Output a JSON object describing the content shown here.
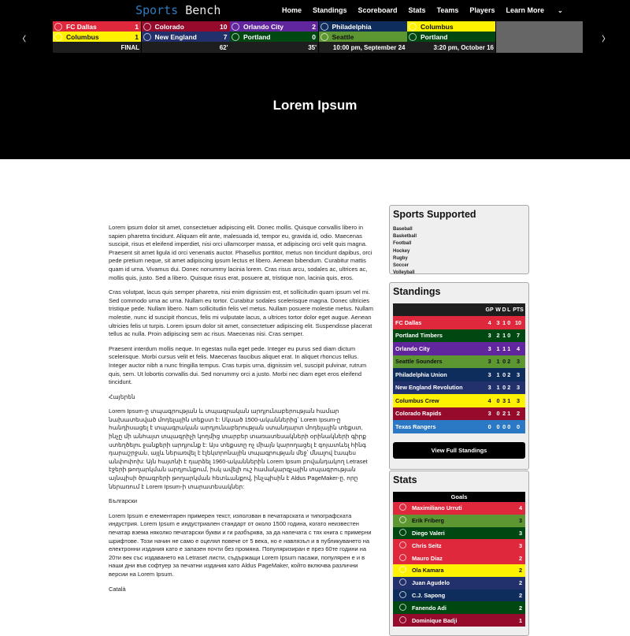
{
  "header": {
    "logo_part1": "Sports",
    "logo_part2": " Bench",
    "nav": [
      "Home",
      "Standings",
      "Scoreboard",
      "Stats",
      "Teams",
      "Players",
      "Learn More"
    ],
    "prev_label": "‹",
    "next_label": "›"
  },
  "scoreboard": [
    {
      "home": {
        "name": "FC Dallas",
        "score": "1",
        "color": "#e0283c"
      },
      "away": {
        "name": "Columbus",
        "score": "1",
        "color": "#fef200",
        "text": "#111"
      },
      "status": "FINAL"
    },
    {
      "home": {
        "name": "Colorado",
        "score": "10",
        "color": "#960a2c"
      },
      "away": {
        "name": "New England",
        "score": "7",
        "color": "#22306b"
      },
      "status": "62'"
    },
    {
      "home": {
        "name": "Orlando City",
        "score": "2",
        "color": "#61259e"
      },
      "away": {
        "name": "Portland",
        "score": "0",
        "color": "#004812"
      },
      "status": "35'"
    },
    {
      "home": {
        "name": "Philadelphia",
        "score": "",
        "color": "#0f2d5c"
      },
      "away": {
        "name": "Seattle",
        "score": "",
        "color": "#5d9732",
        "text": "#111"
      },
      "status": "10:00 pm, September 24"
    },
    {
      "home": {
        "name": "Columbus",
        "score": "",
        "color": "#fef200",
        "text": "#111"
      },
      "away": {
        "name": "Portland",
        "score": "",
        "color": "#004812"
      },
      "status": "3:20 pm, October 16"
    }
  ],
  "hero": {
    "title": "Lorem Ipsum"
  },
  "content": {
    "paragraphs": [
      "Lorem ipsum dolor sit amet, consectetuer adipiscing elit. Donec mollis. Quisque convallis libero in sapien pharetra tincidunt. Aliquam elit ante, malesuada id, tempor eu, gravida id, odio. Maecenas suscipit, risus et eleifend imperdiet, nisi orci ullamcorper massa, et adipiscing orci velit quis magna. Praesent sit amet ligula id orci venenatis auctor. Phasellus porttitor, metus non tincidunt dapibus, orci pede pretium neque, sit amet adipiscing ipsum lectus et libero. Aenean bibendum. Curabitur mattis quam id urna. Vivamus dui. Donec nonummy lacinia lorem. Cras risus arcu, sodales ac, ultrices ac, mollis quis, justo. Sed a libero. Quisque risus erat, posuere at, tristique non, lacinia quis, eros.",
      "Cras volutpat, lacus quis semper pharetra, nisi enim dignissim est, et sollicitudin quam ipsum vel mi. Sed commodo urna ac urna. Nullam eu tortor. Curabitur sodales scelerisque magna. Donec ultricies tristique pede. Nullam libero. Nam sollicitudin felis vel metus. Nullam posuere molestie metus. Nullam molestie, nunc id suscipit rhoncus, felis mi vulputate lacus, a ultrices tortor dolor eget augue. Aenean ultricies felis ut turpis. Lorem ipsum dolor sit amet, consectetuer adipiscing elit. Suspendisse placerat tellus ac nulla. Proin adipiscing sem ac risus. Maecenas nisi. Cras semper.",
      "Praesent interdum mollis neque. In egestas nulla eget pede. Integer eu purus sed diam dictum scelerisque. Morbi cursus velit et felis. Maecenas faucibus aliquet erat. In aliquet rhoncus tellus. Integer auctor nibh a nunc fringilla tempus. Cras turpis urna, dignissim vel, suscipit pulvinar, rutrum quis, sem. Ut lobortis convallis dui. Sed nonummy orci a justo. Morbi nec diam eget eros eleifend tincidunt."
    ],
    "heading_armenian": "Հայերեն",
    "para_armenian": "Lorem Ipsum-ը տպագրության և տպագրական արդյունաբերության համար նախատեսված մոդելային տեքստ է: Սկսած 1500-ականներից՝ Lorem Ipsum-ը հանդիսացել է տպագրական արդյունաբերության ստանդարտ մոդելային տեքստ, ինչը մի անհայտ տպագրիչի կողմից տարբեր տառատեսակների օրինակների գիրք ստեղծելու ջանքերի արդյունք է: Այս տեքստը ոչ միայն կարողացել է գոյատևել հինգ դարաշրջան, այլև ներառվել է էլեկտրոնային տպագրության մեջ՝ մնալով էապես անփոփոխ: Այն հայտնի է դարձել 1960-ականներին Lorem Ipsum բովանդակող Letraset էջերի թողարկման արդյունքում, իսկ ավելի ուշ համակարգչային տպագրության այնպիսի ծրագրերի թողարկման հետևանքով, ինչպիսին է Aldus PageMaker-ը, որը ներառում է Lorem Ipsum-ի տարատեսակներ:",
    "heading_bulgarian": "Български",
    "para_bulgarian": "Lorem Ipsum е елементарен примерен текст, използван в печатарската и типографската индустрия. Lorem Ipsum е индустриален стандарт от около 1500 година, когато неизвестен печатар взема няколко печатарски букви и ги разбърква, за да напечата с тях книга с примерни шрифтове. Този начин не само е оцелял повече от 5 века, но е навлязъл и в публикуването на електронни издания като е запазен почти без промяна. Популяризиран е през 60те години на 20ти век със издаването на Letraset листи, съдържащи Lorem Ipsum пасажи, популярен е и в наши дни във софтуер за печатни издания като Aldus PageMaker, който включва различни версии на Lorem Ipsum.",
    "heading_catalan": "Català"
  },
  "sports_supported": {
    "title": "Sports Supported",
    "items": [
      "Baseball",
      "Basketball",
      "Football",
      "Hockey",
      "Rugby",
      "Soccer",
      "Volleyball"
    ]
  },
  "standings": {
    "title": "Standings",
    "columns": [
      "",
      "GP",
      "W",
      "D",
      "L",
      "PTS"
    ],
    "rows": [
      {
        "team": "FC Dallas",
        "gp": "4",
        "w": "3",
        "d": "1",
        "l": "0",
        "pts": "10",
        "color": "#e0283c",
        "text": "#fff"
      },
      {
        "team": "Portland Timbers",
        "gp": "3",
        "w": "2",
        "d": "1",
        "l": "0",
        "pts": "7",
        "color": "#004812",
        "text": "#fff"
      },
      {
        "team": "Orlando City",
        "gp": "3",
        "w": "1",
        "d": "1",
        "l": "1",
        "pts": "4",
        "color": "#61259e",
        "text": "#fff"
      },
      {
        "team": "Seattle Sounders",
        "gp": "3",
        "w": "1",
        "d": "0",
        "l": "2",
        "pts": "3",
        "color": "#5d9732",
        "text": "#111"
      },
      {
        "team": "Philadelphia Union",
        "gp": "3",
        "w": "1",
        "d": "0",
        "l": "2",
        "pts": "3",
        "color": "#0f2d5c",
        "text": "#fff"
      },
      {
        "team": "New England Revolution",
        "gp": "3",
        "w": "1",
        "d": "0",
        "l": "2",
        "pts": "3",
        "color": "#22306b",
        "text": "#fff"
      },
      {
        "team": "Columbus Crew",
        "gp": "4",
        "w": "0",
        "d": "3",
        "l": "1",
        "pts": "3",
        "color": "#fef200",
        "text": "#111"
      },
      {
        "team": "Colorado Rapids",
        "gp": "3",
        "w": "0",
        "d": "2",
        "l": "1",
        "pts": "2",
        "color": "#960a2c",
        "text": "#fff"
      },
      {
        "team": "Texas Rangers",
        "gp": "0",
        "w": "0",
        "d": "0",
        "l": "0",
        "pts": "0",
        "color": "#2b78c5",
        "text": "#fff"
      }
    ],
    "button_label": "View Full Standings"
  },
  "stats": {
    "title": "Stats",
    "goals_header": "Goals",
    "rows": [
      {
        "player": "Maximiliano Urruti",
        "value": "4",
        "color": "#e0283c",
        "text": "#fff"
      },
      {
        "player": "Erik Friberg",
        "value": "3",
        "color": "#5d9732",
        "text": "#111"
      },
      {
        "player": "Diego Valeri",
        "value": "3",
        "color": "#004812",
        "text": "#fff"
      },
      {
        "player": "Chris Seitz",
        "value": "3",
        "color": "#e0283c",
        "text": "#fff"
      },
      {
        "player": "Mauro Diaz",
        "value": "2",
        "color": "#e0283c",
        "text": "#fff"
      },
      {
        "player": "Ola Kamara",
        "value": "2",
        "color": "#fef200",
        "text": "#111"
      },
      {
        "player": "Juan Agudelo",
        "value": "2",
        "color": "#22306b",
        "text": "#fff"
      },
      {
        "player": "C.J. Sapong",
        "value": "2",
        "color": "#0f2d5c",
        "text": "#fff"
      },
      {
        "player": "Fanendo Adi",
        "value": "2",
        "color": "#004812",
        "text": "#fff"
      },
      {
        "player": "Dominique Badji",
        "value": "1",
        "color": "#960a2c",
        "text": "#fff"
      }
    ]
  }
}
